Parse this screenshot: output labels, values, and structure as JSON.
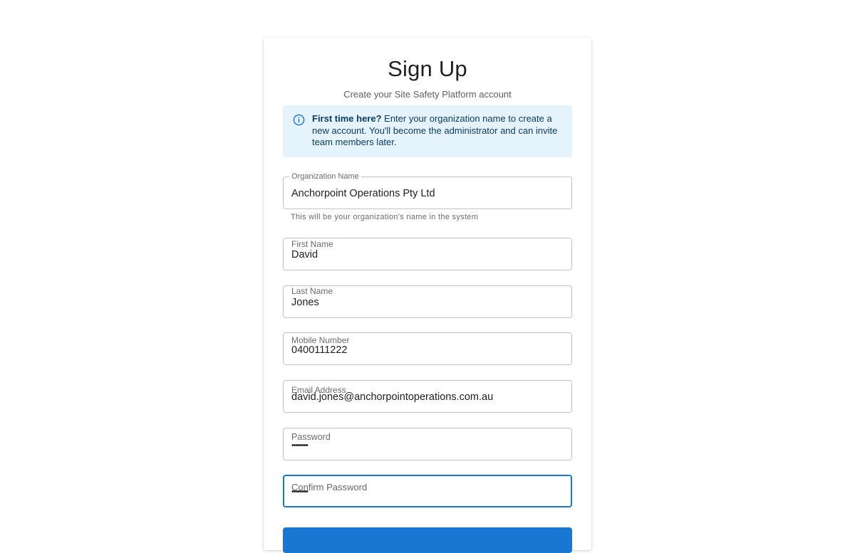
{
  "header": {
    "title": "Sign Up",
    "subtitle": "Create your Site Safety Platform account"
  },
  "info": {
    "icon": "info-icon",
    "bold": "First time here?",
    "text": " Enter your organization name to create a new account. You'll become the administrator and can invite team members later."
  },
  "form": {
    "organization": {
      "label": "Organization Name",
      "value": "Anchorpoint Operations Pty Ltd",
      "helper": "This will be your organization's name in the system"
    },
    "first_name": {
      "label": "First Name",
      "value": "David"
    },
    "last_name": {
      "label": "Last Name",
      "value": "Jones"
    },
    "mobile": {
      "label": "Mobile Number",
      "value": "0400111222"
    },
    "email": {
      "label": "Email Address",
      "value": "david.jones@anchorpointoperations.com.au"
    },
    "password": {
      "label": "Password",
      "value": "••••••••"
    },
    "confirm_password": {
      "label": "Confirm Password",
      "value": "••••••••"
    }
  },
  "colors": {
    "primary": "#1976d2",
    "info_bg": "#e5f3fd",
    "info_text": "#0d3c61"
  }
}
